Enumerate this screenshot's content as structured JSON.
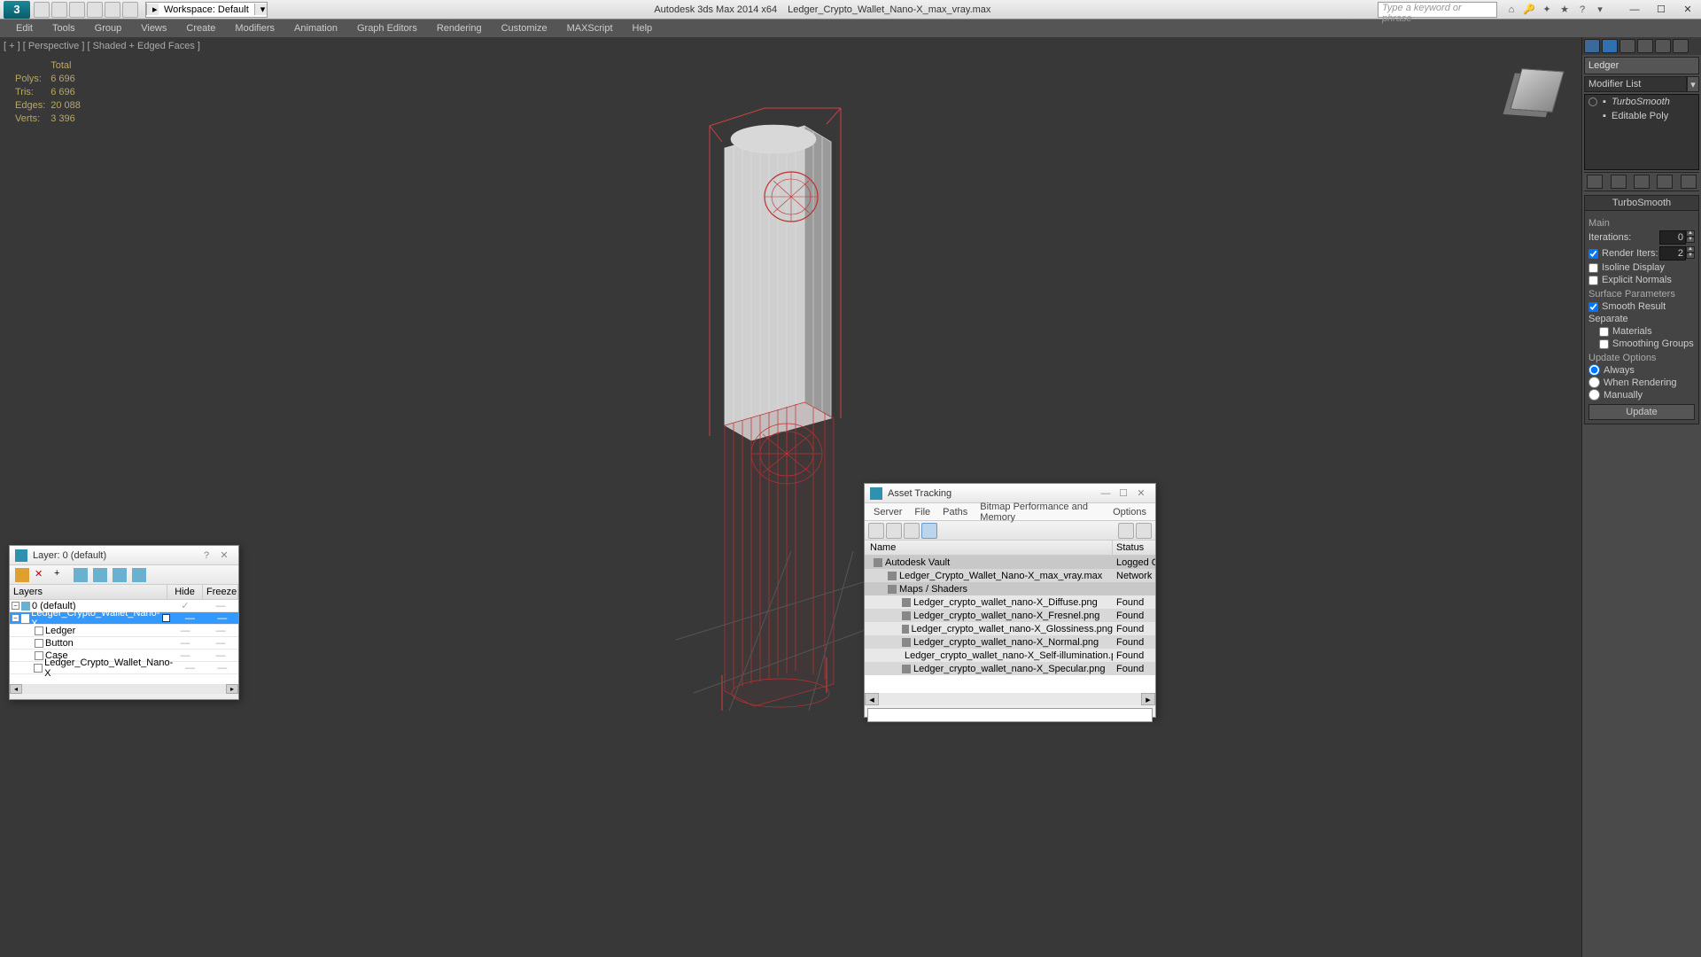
{
  "app": {
    "title_left": "Autodesk 3ds Max  2014 x64",
    "title_file": "Ledger_Crypto_Wallet_Nano-X_max_vray.max",
    "workspace_label": "Workspace: Default",
    "search_placeholder": "Type a keyword or phrase"
  },
  "menu": [
    "Edit",
    "Tools",
    "Group",
    "Views",
    "Create",
    "Modifiers",
    "Animation",
    "Graph Editors",
    "Rendering",
    "Customize",
    "MAXScript",
    "Help"
  ],
  "viewport": {
    "label": "[ + ] [ Perspective ] [ Shaded + Edged Faces ]"
  },
  "stats": {
    "header": "Total",
    "rows": [
      {
        "label": "Polys:",
        "value": "6 696"
      },
      {
        "label": "Tris:",
        "value": "6 696"
      },
      {
        "label": "Edges:",
        "value": "20 088"
      },
      {
        "label": "Verts:",
        "value": "3 396"
      }
    ]
  },
  "command_panel": {
    "object_name": "Ledger",
    "modifier_list_label": "Modifier List",
    "stack": [
      {
        "name": "TurboSmooth",
        "italic": true,
        "eye": true
      },
      {
        "name": "Editable Poly",
        "italic": false,
        "eye": false
      }
    ],
    "turbosmooth": {
      "title": "TurboSmooth",
      "main_label": "Main",
      "iterations_label": "Iterations:",
      "iterations_value": "0",
      "render_iters_label": "Render Iters:",
      "render_iters_value": "2",
      "render_iters_checked": true,
      "isoline_label": "Isoline Display",
      "explicit_label": "Explicit Normals",
      "surface_params_label": "Surface Parameters",
      "smooth_result_label": "Smooth Result",
      "smooth_result_checked": true,
      "separate_label": "Separate",
      "materials_label": "Materials",
      "smoothing_groups_label": "Smoothing Groups",
      "update_options_label": "Update Options",
      "update_modes": [
        "Always",
        "When Rendering",
        "Manually"
      ],
      "update_selected": "Always",
      "update_button": "Update"
    }
  },
  "layer_dialog": {
    "title": "Layer: 0 (default)",
    "columns": [
      "Layers",
      "Hide",
      "Freeze"
    ],
    "rows": [
      {
        "name": "0 (default)",
        "indent": 0,
        "expanded": true,
        "check": true,
        "selected": false,
        "type": "layer"
      },
      {
        "name": "Ledger_Crypto_Wallet_Nano-X",
        "indent": 0,
        "expanded": true,
        "check": false,
        "selected": true,
        "box": true,
        "type": "layer"
      },
      {
        "name": "Ledger",
        "indent": 1,
        "type": "obj"
      },
      {
        "name": "Button",
        "indent": 1,
        "type": "obj"
      },
      {
        "name": "Case",
        "indent": 1,
        "type": "obj"
      },
      {
        "name": "Ledger_Crypto_Wallet_Nano-X",
        "indent": 1,
        "type": "obj"
      }
    ]
  },
  "asset_dialog": {
    "title": "Asset Tracking",
    "menu": [
      "Server",
      "File",
      "Paths",
      "Bitmap Performance and Memory",
      "Options"
    ],
    "columns": [
      "Name",
      "Status"
    ],
    "rows": [
      {
        "name": "Autodesk Vault",
        "status": "Logged O",
        "shade": "dark",
        "indent": 0,
        "icon": "globe"
      },
      {
        "name": "Ledger_Crypto_Wallet_Nano-X_max_vray.max",
        "status": "Network F",
        "shade": "med",
        "indent": 1,
        "icon": "file"
      },
      {
        "name": "Maps / Shaders",
        "status": "",
        "shade": "dark",
        "indent": 1,
        "icon": "folder"
      },
      {
        "name": "Ledger_crypto_wallet_nano-X_Diffuse.png",
        "status": "Found",
        "shade": "light",
        "indent": 2,
        "icon": "img"
      },
      {
        "name": "Ledger_crypto_wallet_nano-X_Fresnel.png",
        "status": "Found",
        "shade": "med",
        "indent": 2,
        "icon": "img"
      },
      {
        "name": "Ledger_crypto_wallet_nano-X_Glossiness.png",
        "status": "Found",
        "shade": "light",
        "indent": 2,
        "icon": "img"
      },
      {
        "name": "Ledger_crypto_wallet_nano-X_Normal.png",
        "status": "Found",
        "shade": "med",
        "indent": 2,
        "icon": "img"
      },
      {
        "name": "Ledger_crypto_wallet_nano-X_Self-illumination.png",
        "status": "Found",
        "shade": "light",
        "indent": 2,
        "icon": "img"
      },
      {
        "name": "Ledger_crypto_wallet_nano-X_Specular.png",
        "status": "Found",
        "shade": "med",
        "indent": 2,
        "icon": "img"
      }
    ]
  }
}
